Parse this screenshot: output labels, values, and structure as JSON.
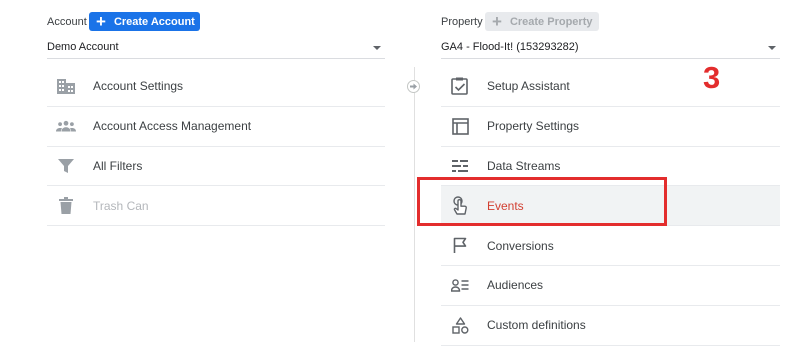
{
  "account": {
    "label": "Account",
    "create_button": "Create Account",
    "selected": "Demo Account",
    "menu": [
      {
        "label": "Account Settings",
        "icon": "building-icon",
        "enabled": true
      },
      {
        "label": "Account Access Management",
        "icon": "people-icon",
        "enabled": true
      },
      {
        "label": "All Filters",
        "icon": "filter-icon",
        "enabled": true
      },
      {
        "label": "Trash Can",
        "icon": "trash-icon",
        "enabled": false
      }
    ]
  },
  "property": {
    "label": "Property",
    "create_button": "Create Property",
    "selected": "GA4 - Flood-It! (153293282)",
    "menu": [
      {
        "label": "Setup Assistant",
        "icon": "checkbox-icon"
      },
      {
        "label": "Property Settings",
        "icon": "layout-icon"
      },
      {
        "label": "Data Streams",
        "icon": "streams-icon"
      },
      {
        "label": "Events",
        "icon": "touch-icon",
        "active": true
      },
      {
        "label": "Conversions",
        "icon": "flag-icon"
      },
      {
        "label": "Audiences",
        "icon": "audience-icon"
      },
      {
        "label": "Custom definitions",
        "icon": "shapes-icon"
      }
    ]
  },
  "annotation": {
    "step": "3",
    "color": "#e32d2d"
  },
  "colors": {
    "accent": "#1a73e8",
    "active_text": "#d23f31",
    "icon": "#5f6368"
  }
}
